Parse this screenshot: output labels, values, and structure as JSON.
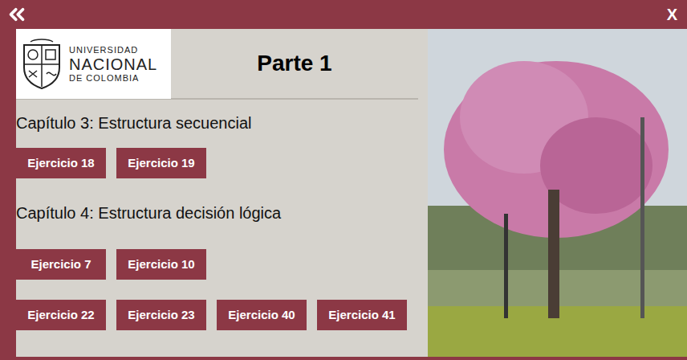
{
  "window": {
    "close": "X"
  },
  "logo": {
    "lines": [
      "UNIVERSIDAD",
      "NACIONAL",
      "DE COLOMBIA"
    ]
  },
  "title": "Parte 1",
  "chapters": [
    {
      "title": "Capítulo 3: Estructura secuencial",
      "rows": [
        [
          "Ejercicio 18",
          "Ejercicio 19"
        ]
      ]
    },
    {
      "title": "Capítulo 4: Estructura decisión lógica",
      "rows": [
        [
          "Ejercicio 7",
          "Ejercicio 10"
        ],
        [
          "Ejercicio 22",
          "Ejercicio 23",
          "Ejercicio 40",
          "Ejercicio 41"
        ]
      ]
    }
  ]
}
